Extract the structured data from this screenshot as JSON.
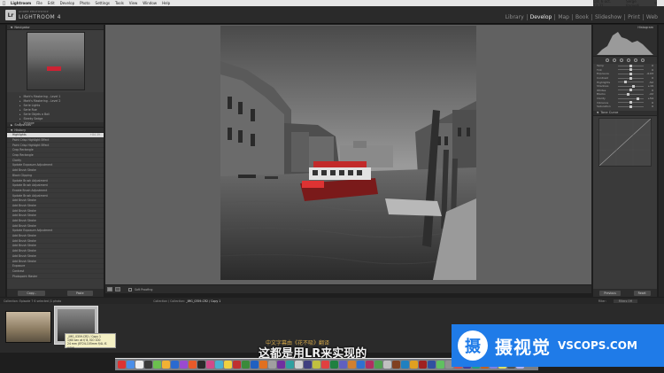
{
  "menubar": {
    "app": "Lightroom",
    "items": [
      "File",
      "Edit",
      "Develop",
      "Photo",
      "Settings",
      "Tools",
      "View",
      "Window",
      "Help"
    ],
    "clock": "Lat. 6 oct.  23:31",
    "user": "Serge Ramelli"
  },
  "identity": {
    "logo": "Lr",
    "subtitle": "ADOBE PHOTOSHOP",
    "title": "LIGHTROOM 4"
  },
  "modules": [
    {
      "label": "Library",
      "active": false
    },
    {
      "label": "Develop",
      "active": true
    },
    {
      "label": "Map",
      "active": false
    },
    {
      "label": "Book",
      "active": false
    },
    {
      "label": "Slideshow",
      "active": false
    },
    {
      "label": "Print",
      "active": false
    },
    {
      "label": "Web",
      "active": false
    }
  ],
  "left_panel": {
    "navigator": "Navigator",
    "presets": [
      "Mark's Mastering - Level 1",
      "Mark's Mastering - Level 2",
      "Serie Lights",
      "Serie Rue",
      "Serie Objets a Bali",
      "Steeky Sedge",
      "Vintage"
    ],
    "snapshots": "Snapshots",
    "history": "History",
    "history_items": [
      {
        "label": "Highlights",
        "value": "+84  39",
        "selected": true
      },
      {
        "label": "Paint Crisp Highlight Effect",
        "value": ""
      },
      {
        "label": "Paint Crisp Highlight Effect",
        "value": ""
      },
      {
        "label": "Crop Rectangle",
        "value": ""
      },
      {
        "label": "Crop Rectangle",
        "value": ""
      },
      {
        "label": "Clarity",
        "value": ""
      },
      {
        "label": "Update Exposure Adjustment",
        "value": ""
      },
      {
        "label": "Add Brush Stroke",
        "value": ""
      },
      {
        "label": "Black Clipping",
        "value": ""
      },
      {
        "label": "Update Brush Adjustment",
        "value": ""
      },
      {
        "label": "Update Brush Adjustment",
        "value": ""
      },
      {
        "label": "Enable Brush Adjustment",
        "value": ""
      },
      {
        "label": "Update Brush Adjustment",
        "value": ""
      },
      {
        "label": "Add Brush Stroke",
        "value": ""
      },
      {
        "label": "Add Brush Stroke",
        "value": ""
      },
      {
        "label": "Add Brush Stroke",
        "value": ""
      },
      {
        "label": "Add Brush Stroke",
        "value": ""
      },
      {
        "label": "Add Brush Stroke",
        "value": ""
      },
      {
        "label": "Add Brush Stroke",
        "value": ""
      },
      {
        "label": "Update Exposure Adjustment",
        "value": ""
      },
      {
        "label": "Add Brush Stroke",
        "value": ""
      },
      {
        "label": "Add Brush Stroke",
        "value": ""
      },
      {
        "label": "Add Brush Stroke",
        "value": ""
      },
      {
        "label": "Add Brush Stroke",
        "value": ""
      },
      {
        "label": "Add Brush Stroke",
        "value": ""
      },
      {
        "label": "Add Brush Stroke",
        "value": ""
      },
      {
        "label": "Exposure",
        "value": ""
      },
      {
        "label": "Contrast",
        "value": ""
      },
      {
        "label": "Photopoint Master",
        "value": ""
      }
    ],
    "copy_label": "Copy...",
    "paste_label": "Paste"
  },
  "toolbar": {
    "soft_proofing": "Soft Proofing"
  },
  "right_panel": {
    "histogram": "Histogram",
    "basic_rows": [
      {
        "label": "Temp",
        "value": "0",
        "pos": 0.5
      },
      {
        "label": "Tint",
        "value": "0",
        "pos": 0.5
      },
      {
        "label": "Exposure",
        "value": "-0.03",
        "pos": 0.5
      },
      {
        "label": "Contrast",
        "value": "0",
        "pos": 0.5
      },
      {
        "label": "Highlights",
        "value": "-52",
        "pos": 0.3
      },
      {
        "label": "Shadows",
        "value": "+19",
        "pos": 0.6
      },
      {
        "label": "Whites",
        "value": "0",
        "pos": 0.5
      },
      {
        "label": "Blacks",
        "value": "-22",
        "pos": 0.4
      },
      {
        "label": "Clarity",
        "value": "+54",
        "pos": 0.78
      },
      {
        "label": "Vibrance",
        "value": "0",
        "pos": 0.5
      },
      {
        "label": "Saturation",
        "value": "0",
        "pos": 0.5
      }
    ],
    "tone_curve": "Tone Curve",
    "previous_label": "Previous",
    "reset_label": "Reset"
  },
  "filmstrip": {
    "info": "Collection: Episode 7   6 selected  /1 photo",
    "crumb_prefix": "Collection / Collection:",
    "crumb_file": "_IMG_0359-CR2 / Copy 1",
    "filter_label": "Filter:",
    "filter_value": "Filters Off",
    "tooltip_lines": [
      "_IMG_0359.CR2 / Copy 1",
      "1/60 sec at f/ 8, ISO 100",
      "24 mm (EF24-105mm f/4L IS USM)"
    ]
  },
  "subtitles": {
    "small": "中文字幕由《花不吸》翻译",
    "main": "这都是用LR来实现的"
  },
  "watermark": {
    "glyph": "摄",
    "cn": "摄视觉",
    "en": "VSCOPS.COM"
  },
  "colors": {
    "accent_watermark": "#1f7be8",
    "subtitle_yellow": "#d4a84a",
    "boat_red": "#c22a2a"
  }
}
